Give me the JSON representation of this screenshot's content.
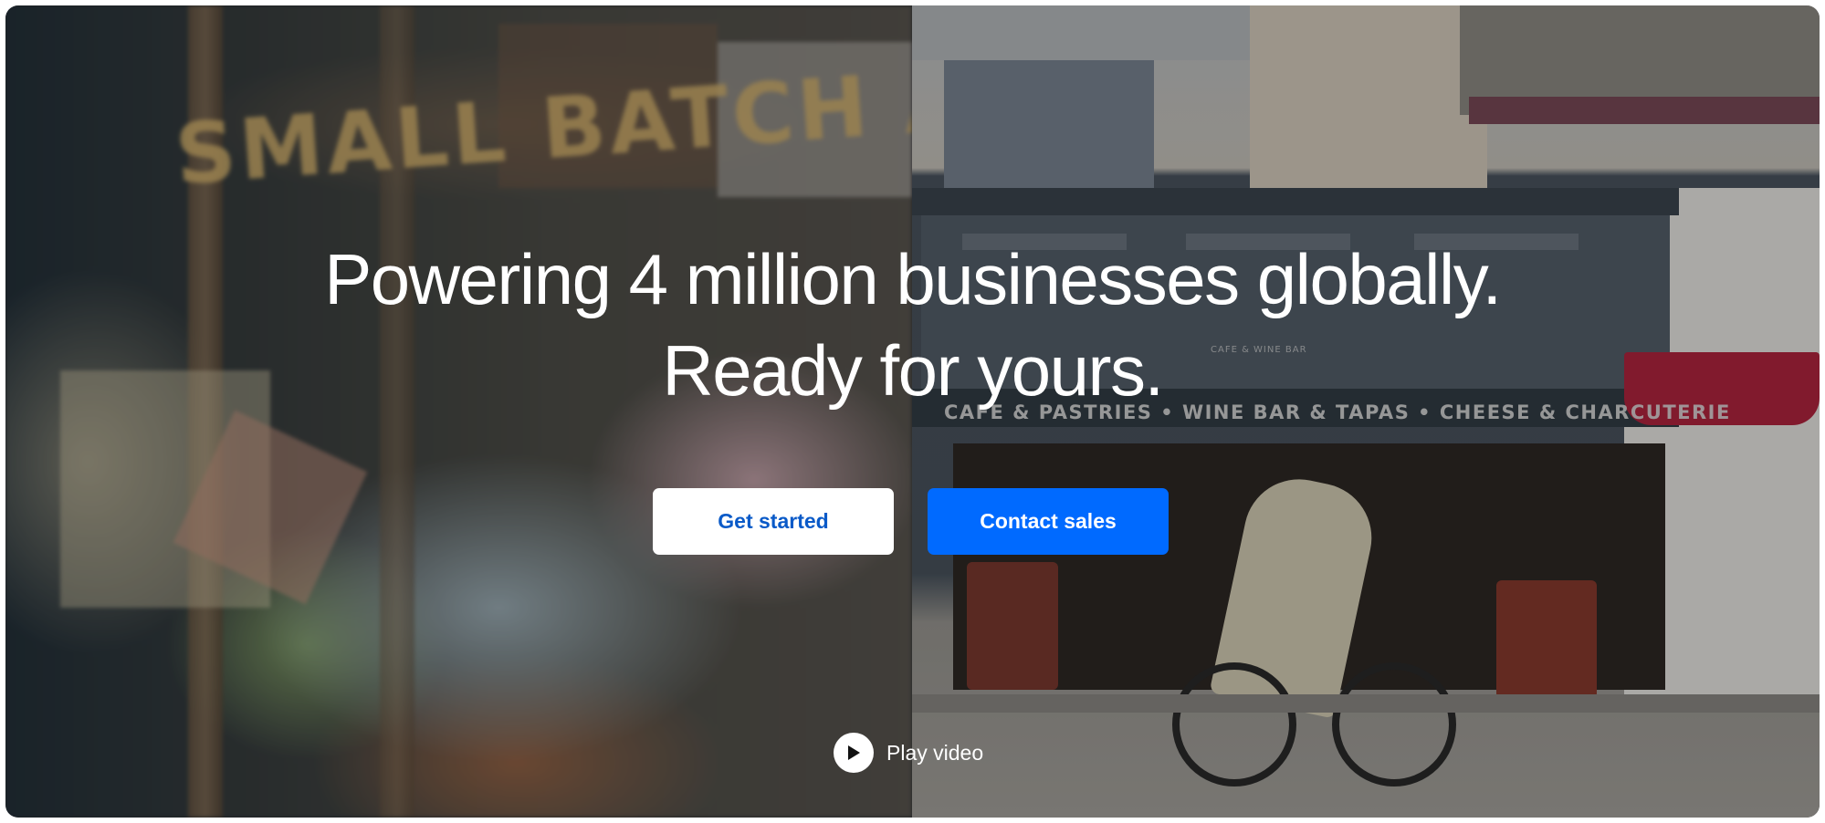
{
  "hero": {
    "headline_line1": "Powering 4 million businesses globally.",
    "headline_line2": "Ready for yours.",
    "background_image": {
      "left_sign_text": "SMALL BATCH ART",
      "awning_text": "CAFE & PASTRIES • WINE BAR & TAPAS • CHEESE & CHARCUTERIE",
      "sub_sign_text": "CAFE & WINE BAR"
    }
  },
  "buttons": {
    "get_started_label": "Get started",
    "contact_sales_label": "Contact sales"
  },
  "video": {
    "play_label": "Play video",
    "icon": "play-icon"
  },
  "colors": {
    "primary_blue": "#006aff",
    "secondary_text_blue": "#0a5ac8",
    "button_white": "#ffffff"
  }
}
